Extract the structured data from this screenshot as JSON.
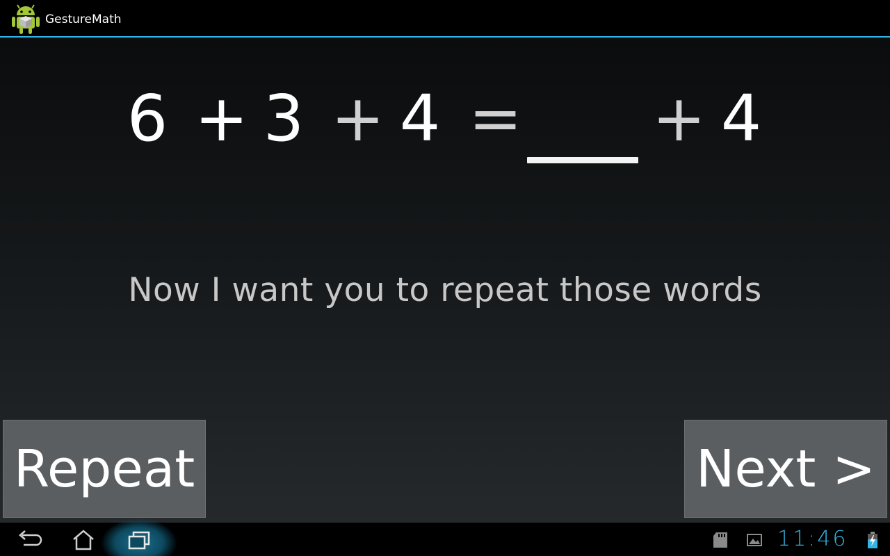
{
  "app": {
    "title": "GestureMath",
    "icon": "android-robot-icon"
  },
  "equation": {
    "tokens": [
      "6",
      "+",
      "3",
      "+",
      "4",
      "=",
      "+",
      "4"
    ],
    "blank_answer": ""
  },
  "prompt": "Now I want you to repeat those words",
  "buttons": {
    "repeat": "Repeat",
    "next": "Next >"
  },
  "system_bar": {
    "time": "11:46",
    "icons": [
      "back-icon",
      "home-icon",
      "recent-apps-icon",
      "sd-card-icon",
      "image-icon",
      "battery-charging-icon"
    ]
  },
  "colors": {
    "accent": "#33b5e5",
    "button_bg": "#5a5e61"
  }
}
